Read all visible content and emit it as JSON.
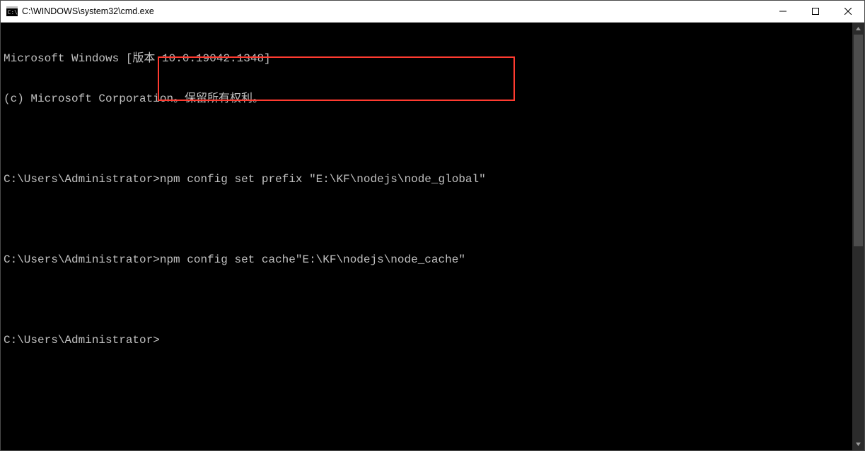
{
  "window": {
    "title": "C:\\WINDOWS\\system32\\cmd.exe"
  },
  "console": {
    "header_line1": "Microsoft Windows [版本 10.0.19042.1348]",
    "header_line2": "(c) Microsoft Corporation。保留所有权利。",
    "lines": [
      {
        "prompt": "C:\\Users\\Administrator>",
        "command": "npm config set prefix \"E:\\KF\\nodejs\\node_global\""
      },
      {
        "prompt": "C:\\Users\\Administrator>",
        "command": "npm config set cache\"E:\\KF\\nodejs\\node_cache\""
      },
      {
        "prompt": "C:\\Users\\Administrator>",
        "command": ""
      }
    ]
  },
  "icons": {
    "app": "cmd-icon",
    "min": "minimize-icon",
    "max": "maximize-icon",
    "close": "close-icon",
    "up": "scroll-up-icon",
    "down": "scroll-down-icon"
  }
}
